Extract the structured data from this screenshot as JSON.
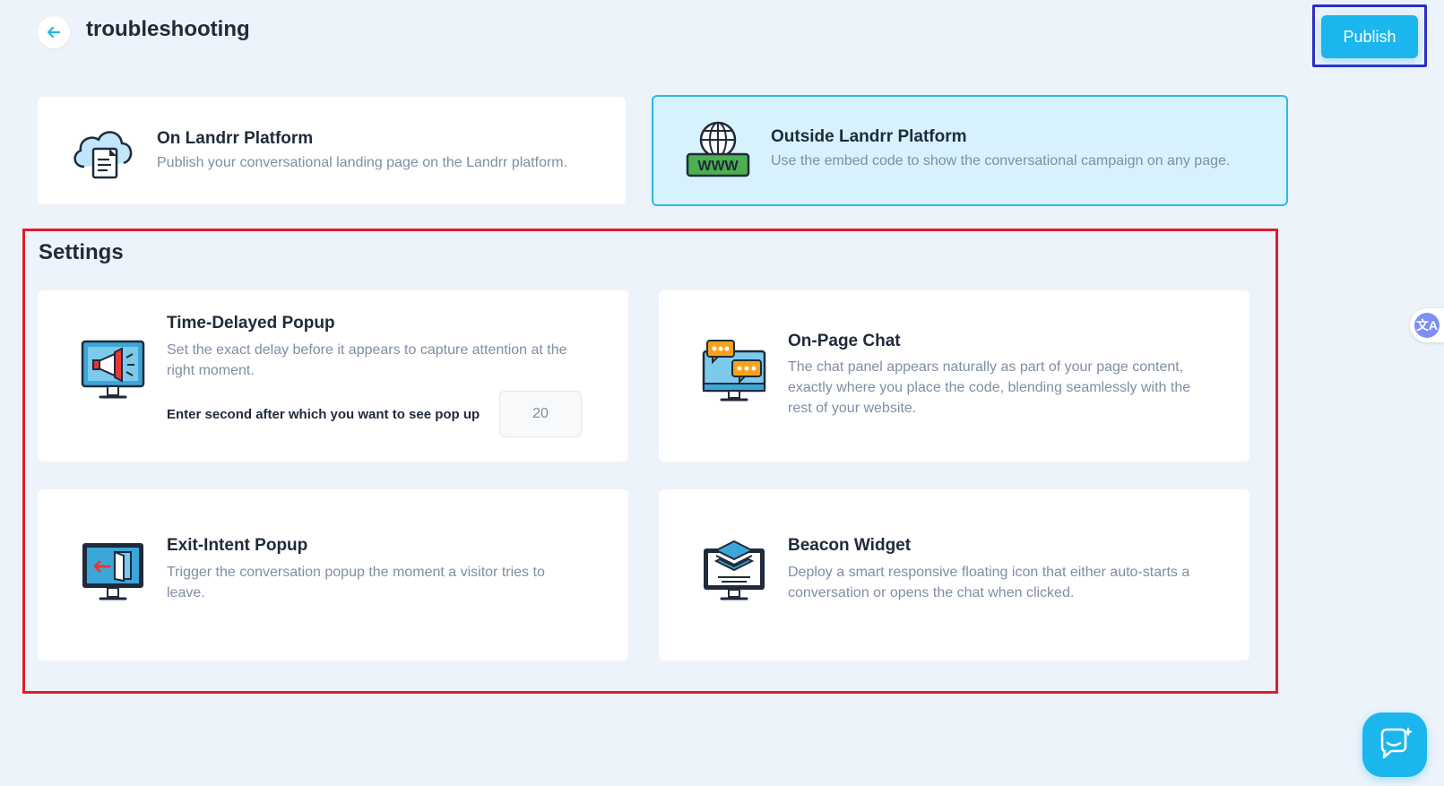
{
  "header": {
    "title": "troubleshooting",
    "publish_label": "Publish"
  },
  "platforms": [
    {
      "title": "On Landrr Platform",
      "desc": "Publish your conversational landing page on the Landrr platform.",
      "icon": "cloud-document-icon"
    },
    {
      "title": "Outside Landrr Platform",
      "desc": "Use the embed code to show the conversational campaign on any page.",
      "icon": "globe-www-icon",
      "selected": true
    }
  ],
  "settings": {
    "title": "Settings",
    "cards": [
      {
        "title": "Time-Delayed Popup",
        "desc": "Set the exact delay before it appears to capture attention at the right moment.",
        "icon": "megaphone-monitor-icon",
        "delay_label": "Enter second after which you want to see pop up",
        "delay_value": "20"
      },
      {
        "title": "On-Page Chat",
        "desc": "The chat panel appears naturally as part of your page content, exactly where you place the code, blending seamlessly with the rest of your website.",
        "icon": "chat-monitor-icon"
      },
      {
        "title": "Exit-Intent Popup",
        "desc": "Trigger the conversation popup the moment a visitor tries to leave.",
        "icon": "exit-door-monitor-icon"
      },
      {
        "title": "Beacon Widget",
        "desc": "Deploy a smart responsive floating icon that either auto-starts a conversation or opens the chat when clicked.",
        "icon": "layers-monitor-icon"
      }
    ]
  },
  "widgets": {
    "translate_glyph": "文A"
  },
  "colors": {
    "accent": "#1bb6ee",
    "selected_bg": "#d7f2fd",
    "page_bg": "#edf3fa",
    "highlight_red": "#e11d2b",
    "highlight_blue": "#2d2dc8"
  }
}
